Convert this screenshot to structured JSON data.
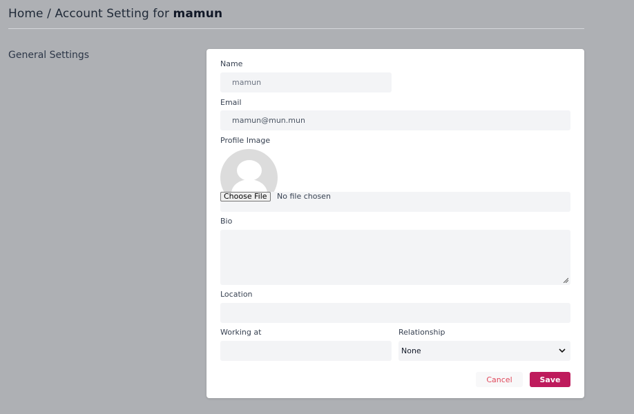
{
  "header": {
    "breadcrumb_prefix": "Home / Account Setting for",
    "username": "mamun"
  },
  "sidebar": {
    "section_title": "General Settings"
  },
  "form": {
    "name": {
      "label": "Name",
      "value": "mamun"
    },
    "email": {
      "label": "Email",
      "value": "mamun@mun.mun"
    },
    "profile_image": {
      "label": "Profile Image",
      "choose_button": "Choose File",
      "file_status": "No file chosen"
    },
    "bio": {
      "label": "Bio",
      "value": ""
    },
    "location": {
      "label": "Location",
      "value": ""
    },
    "working_at": {
      "label": "Working at",
      "value": ""
    },
    "relationship": {
      "label": "Relationship",
      "selected": "None"
    },
    "cancel_label": "Cancel",
    "save_label": "Save"
  },
  "colors": {
    "page_bg": "#aeb0b4",
    "card_bg": "#ffffff",
    "field_bg": "#f3f4f6",
    "accent": "#be1b5c",
    "cancel_text": "#e0475a"
  }
}
